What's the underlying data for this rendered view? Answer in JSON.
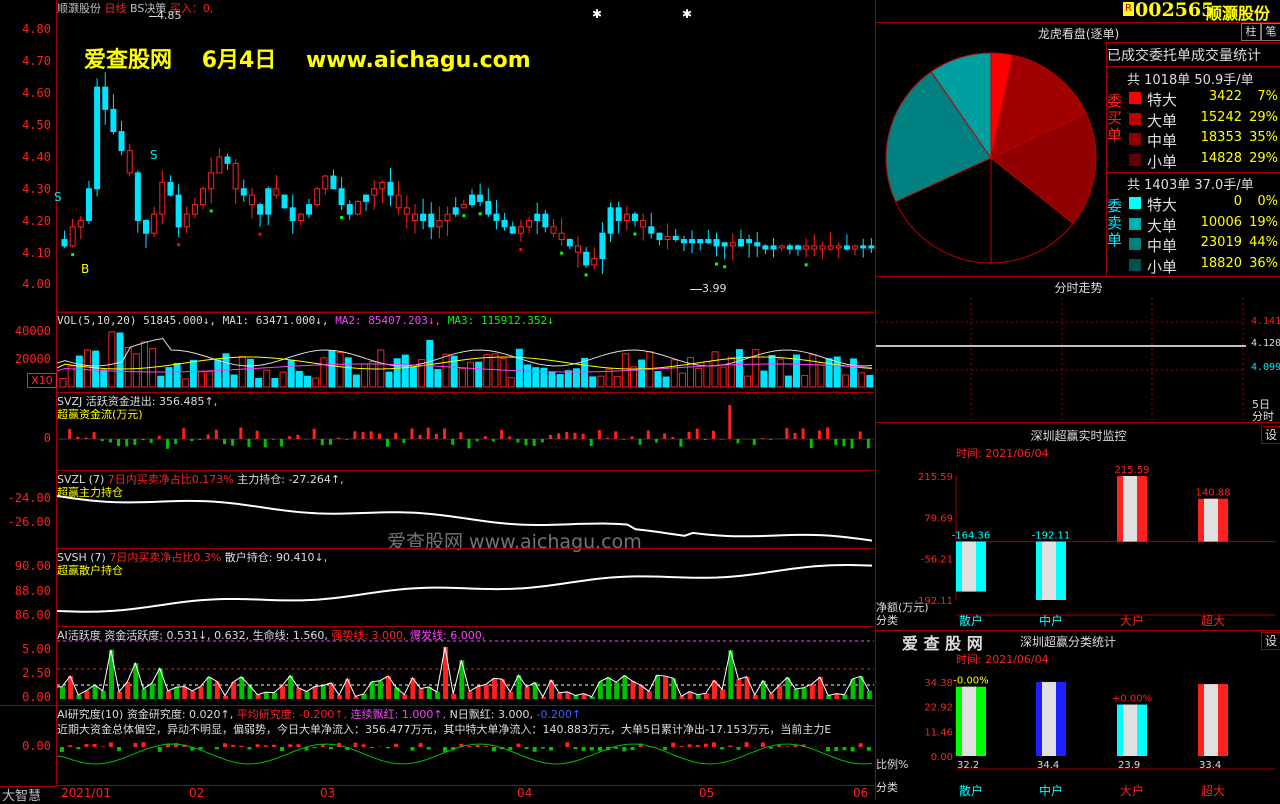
{
  "header": {
    "stock_name": "顺灏股份",
    "period": "日线",
    "indicator": "BS决策",
    "buy_label": "买入：",
    "buy_value": "0,",
    "high_mark": "4.85"
  },
  "watermark": {
    "site": "爱查股网",
    "date": "6月4日",
    "url": "www.aichagu.com",
    "center_text": "爱查股网 www.aichagu.com"
  },
  "price_axis": [
    "4.80",
    "4.70",
    "4.60",
    "4.50",
    "4.40",
    "4.30",
    "4.20",
    "4.10",
    "4.00"
  ],
  "price_markers": {
    "s1": "S",
    "s2": "S",
    "b": "B",
    "low": "3.99"
  },
  "vol": {
    "title": "VOL(5,10,20)",
    "v": "51845.000↓,",
    "ma1": "MA1: 63471.000↓,",
    "ma2": "MA2: 85407.203↓,",
    "ma3": "MA3: 115912.352↓",
    "axis": [
      "40000",
      "20000"
    ],
    "unit": "X10"
  },
  "svzj": {
    "title": "SVZJ  活跃资金进出: 356.485↑,",
    "sub": "超赢资金流(万元)",
    "axis": [
      "0"
    ]
  },
  "svzl": {
    "title": "SVZL (7)",
    "ratio": "7日内买卖净占比0.173%",
    "hold": "主力持仓: -27.264↑,",
    "sub": "超赢主力持仓",
    "axis": [
      "-24.00",
      "-26.00"
    ]
  },
  "svsh": {
    "title": "SVSH (7)",
    "ratio": "7日内买卖净占比0.3%",
    "hold": "散户持仓: 90.410↓,",
    "sub": "超赢散户持仓",
    "axis": [
      "90.00",
      "88.00",
      "86.00"
    ]
  },
  "ai_active": {
    "title": "AI活跃度  资金活跃度: 0.531↓, 0.632, 生命线: 1.560,",
    "strong": "强势线: 3.000,",
    "burst": "爆发线: 6.000,",
    "axis": [
      "5.00",
      "2.50",
      "0.00"
    ]
  },
  "ai_research": {
    "title": "AI研究度(10) 资金研究度: 0.020↑,",
    "avg": "平均研究度: -0.200↑,",
    "red": "连续飘红: 1.000↑,",
    "nred": "N日飘红: 3.000,",
    "last": "-0.200↑",
    "text": "近期大资金总体偏空，异动不明显，偏弱势，今日大单净流入：356.477万元，其中特大单净流入：140.883万元，大单5日累计净出-17.153万元，当前主力E",
    "axis": [
      "0.00"
    ]
  },
  "left_footer": "大智慧",
  "x_axis": [
    "2021/01",
    "02",
    "03",
    "04",
    "05",
    "06"
  ],
  "right": {
    "badge": "R",
    "code": "002565",
    "name": "顺灏股份",
    "tab1": "柱",
    "tab2": "笔",
    "lh_title": "龙虎看盘(逐单)",
    "stats_title": "已成交委托单成交量统计",
    "buy_total": "共 1018单 50.9手/单",
    "buy_label": "委买单",
    "sell_total": "共 1403单 37.0手/单",
    "sell_label": "委卖单",
    "buy_rows": [
      {
        "name": "特大",
        "vol": "3422",
        "pct": "7%",
        "color": "#ff0000"
      },
      {
        "name": "大单",
        "vol": "15242",
        "pct": "29%",
        "color": "#c00000"
      },
      {
        "name": "中单",
        "vol": "18353",
        "pct": "35%",
        "color": "#900000"
      },
      {
        "name": "小单",
        "vol": "14828",
        "pct": "29%",
        "color": "#600000"
      }
    ],
    "sell_rows": [
      {
        "name": "特大",
        "vol": "0",
        "pct": "0%",
        "color": "#00ffff"
      },
      {
        "name": "大单",
        "vol": "10006",
        "pct": "19%",
        "color": "#00b0b0"
      },
      {
        "name": "中单",
        "vol": "23019",
        "pct": "44%",
        "color": "#008080"
      },
      {
        "name": "小单",
        "vol": "18820",
        "pct": "36%",
        "color": "#005050"
      }
    ],
    "fs_title": "分时走势",
    "fs_axis": [
      "4.141",
      "4.120",
      "4.099"
    ],
    "fs_unit": "分时",
    "fs_unit2": "5日",
    "monitor_title": "深圳超赢实时监控",
    "set": "设",
    "time": "时间: 2021/06/04",
    "mon_axis": [
      "215.59",
      "79.69",
      "-56.21",
      "-192.11"
    ],
    "mon_ylabel": "净额(万元)",
    "mon_xlabel": "分类",
    "mon_values": [
      "-164.36",
      "-192.11",
      "215.59",
      "140.88"
    ],
    "cats": [
      "散户",
      "中户",
      "大户",
      "超大"
    ],
    "brand": "爱 查 股 网",
    "cls_title": "深圳超赢分类统计",
    "cls_time": "时间: 2021/06/04",
    "cls_axis": [
      "34.38",
      "22.92",
      "11.46",
      "0.00"
    ],
    "cls_pct": [
      "-0.00%",
      "",
      "+0.00%",
      ""
    ],
    "cls_values": [
      "32.2",
      "34.4",
      "23.9",
      "33.4"
    ],
    "cls_ylabel": "比例%",
    "cls_xlabel": "分类"
  },
  "chart_data": {
    "type": "table",
    "pie_buy_sell": {
      "buy": [
        {
          "name": "特大",
          "value": 3422
        },
        {
          "name": "大单",
          "value": 15242
        },
        {
          "name": "中单",
          "value": 18353
        },
        {
          "name": "小单",
          "value": 14828
        }
      ],
      "sell": [
        {
          "name": "特大",
          "value": 0
        },
        {
          "name": "大单",
          "value": 10006
        },
        {
          "name": "中单",
          "value": 23019
        },
        {
          "name": "小单",
          "value": 18820
        }
      ]
    },
    "monitor": {
      "categories": [
        "散户",
        "中户",
        "大户",
        "超大"
      ],
      "values": [
        -164.36,
        -192.11,
        215.59,
        140.88
      ],
      "ylim": [
        -192.11,
        215.59
      ]
    },
    "classify": {
      "categories": [
        "散户",
        "中户",
        "大户",
        "超大"
      ],
      "values": [
        32.2,
        34.4,
        23.9,
        33.4
      ],
      "ylim": [
        0,
        34.38
      ]
    }
  },
  "colors": {
    "up": "#ff2020",
    "down": "#00e5ff",
    "border": "#a00000",
    "yellow": "#ffff00",
    "magenta": "#ff40ff"
  }
}
